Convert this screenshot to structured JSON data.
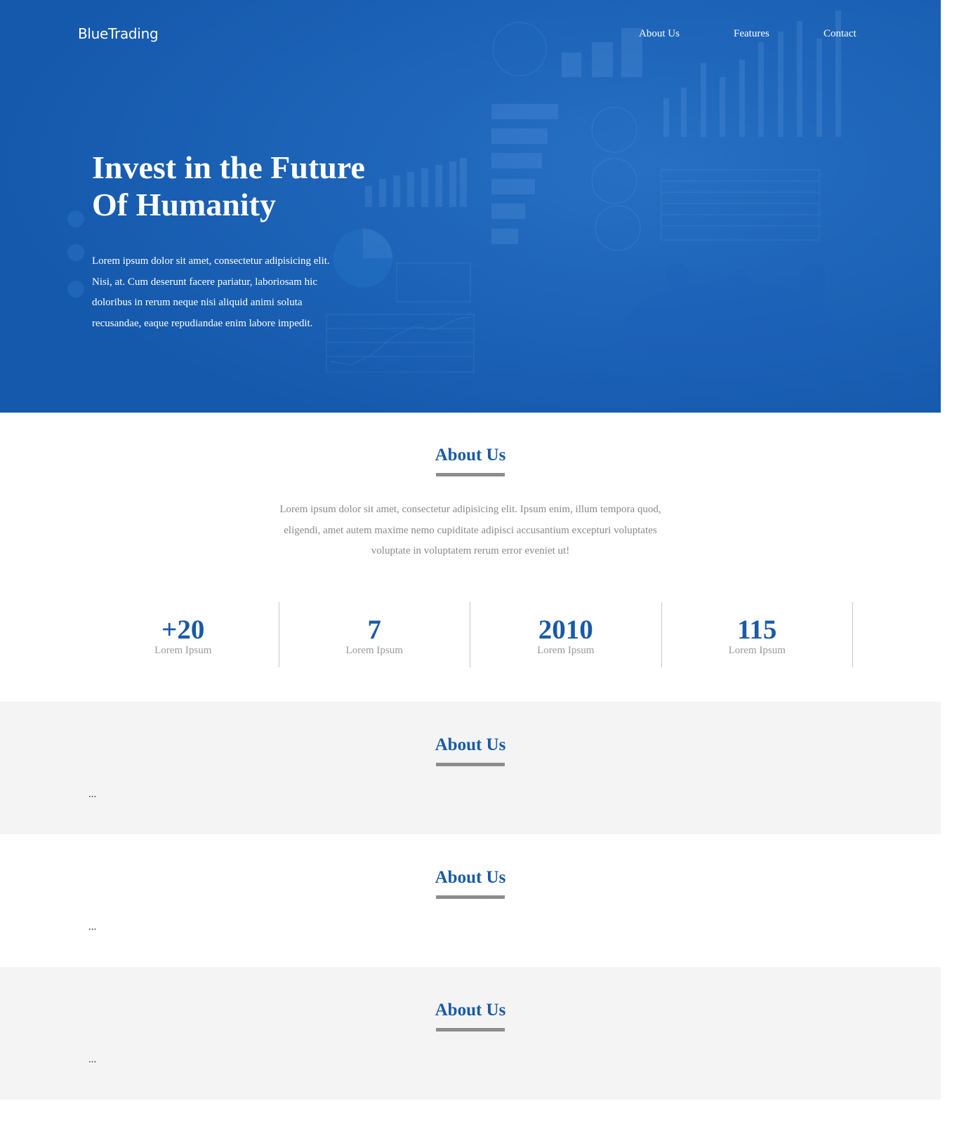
{
  "brand": {
    "name": "BlueTrading"
  },
  "nav": {
    "items": [
      {
        "label": "About Us"
      },
      {
        "label": "Features"
      },
      {
        "label": "Contact"
      }
    ]
  },
  "hero": {
    "title_line1": "Invest in the Future",
    "title_line2": "Of Humanity",
    "text": "Lorem ipsum dolor sit amet, consectetur adipisicing elit. Nisi, at. Cum deserunt facere pariatur, laboriosam hic doloribus in rerum neque nisi aliquid animi soluta recusandae, eaque repudiandae enim labore impedit."
  },
  "about": {
    "title": "About Us",
    "text": "Lorem ipsum dolor sit amet, consectetur adipisicing elit. Ipsum enim, illum tempora quod, eligendi, amet autem maxime nemo cupiditate adipisci accusantium excepturi voluptates voluptate in voluptatem rerum error eveniet ut!",
    "stats": [
      {
        "value": "+20",
        "label": "Lorem Ipsum"
      },
      {
        "value": "7",
        "label": "Lorem Ipsum"
      },
      {
        "value": "2010",
        "label": "Lorem Ipsum"
      },
      {
        "value": "115",
        "label": "Lorem Ipsum"
      }
    ]
  },
  "sections": [
    {
      "title": "About Us",
      "content": "..."
    },
    {
      "title": "About Us",
      "content": "..."
    },
    {
      "title": "About Us",
      "content": "..."
    }
  ],
  "colors": {
    "hero_bg": "#1a5fb4",
    "accent": "#1a5aa6",
    "title_bar": "#8c8c8c",
    "alt_section_bg": "#f4f4f4"
  }
}
